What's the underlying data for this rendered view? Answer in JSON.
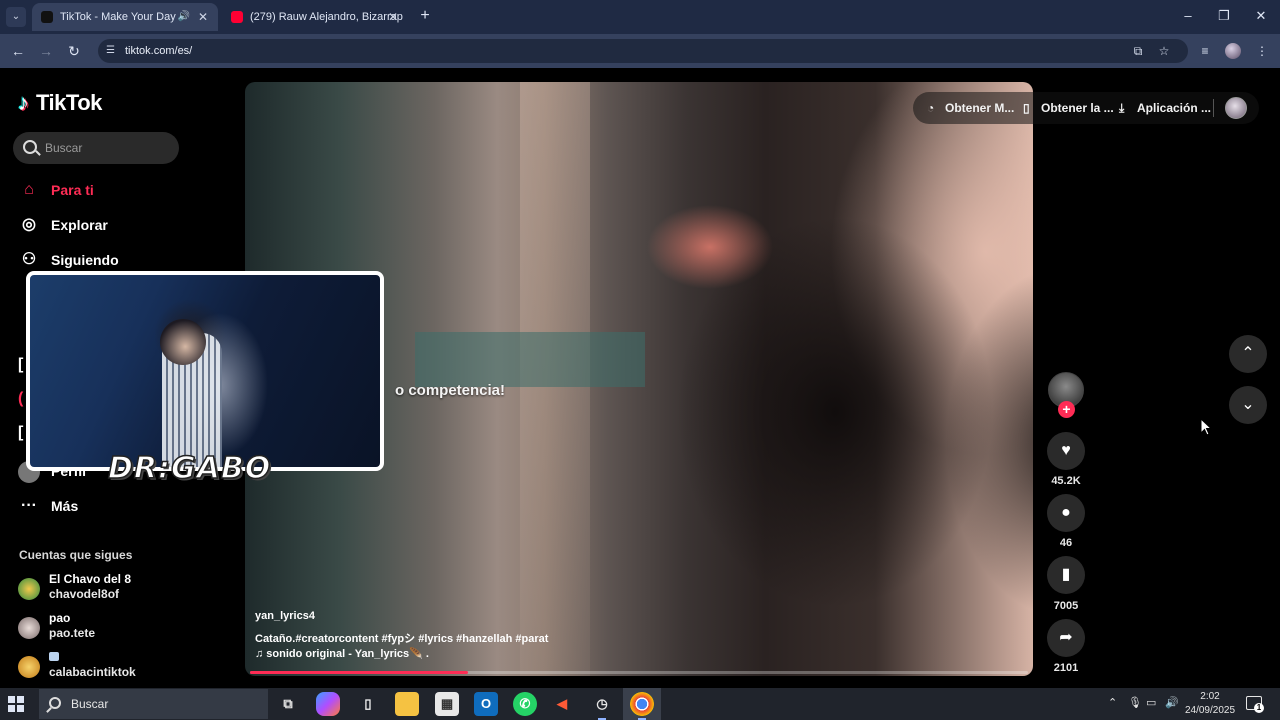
{
  "browser": {
    "tabs": [
      {
        "title": "TikTok - Make Your Day",
        "active": true
      },
      {
        "title": "(279) Rauw Alejandro, Bizarrap",
        "active": false
      }
    ],
    "url": "tiktok.com/es/"
  },
  "sidebar": {
    "logo": "TikTok",
    "search_placeholder": "Buscar",
    "nav": [
      {
        "label": "Para ti",
        "icon": "home-icon",
        "active": true
      },
      {
        "label": "Explorar",
        "icon": "compass-icon"
      },
      {
        "label": "Siguiendo",
        "icon": "following-icon"
      },
      {
        "label": "Perfil",
        "icon": "profile-icon"
      },
      {
        "label": "Más",
        "icon": "more-icon"
      }
    ],
    "following_header": "Cuentas que sigues",
    "accounts": [
      {
        "name": "El Chavo del 8",
        "handle": "chavodel8of"
      },
      {
        "name": "pao",
        "handle": "pao.tete"
      },
      {
        "name": "",
        "handle": "calabacintiktok"
      }
    ]
  },
  "top_actions": [
    {
      "label": "Obtener M...",
      "icon": "coin-icon"
    },
    {
      "label": "Obtener la ...",
      "icon": "phone-icon"
    },
    {
      "label": "Aplicación ...",
      "icon": "download-icon"
    }
  ],
  "video": {
    "overlay_text": "o competencia!",
    "author": "yan_lyrics4",
    "description": "Cataño.#creatorcontent #fypシ #lyrics #hanzellah #parat",
    "sound": "♫  sonido original - Yan_lyrics🪶 .",
    "progress": 0.28,
    "likes": "45.2K",
    "comments": "46",
    "saves": "7005",
    "shares": "2101"
  },
  "webcam": {
    "watermark": "DR:GABO"
  },
  "taskbar": {
    "search_label": "Buscar",
    "time": "2:02",
    "date": "24/09/2025",
    "notification_count": "1"
  }
}
